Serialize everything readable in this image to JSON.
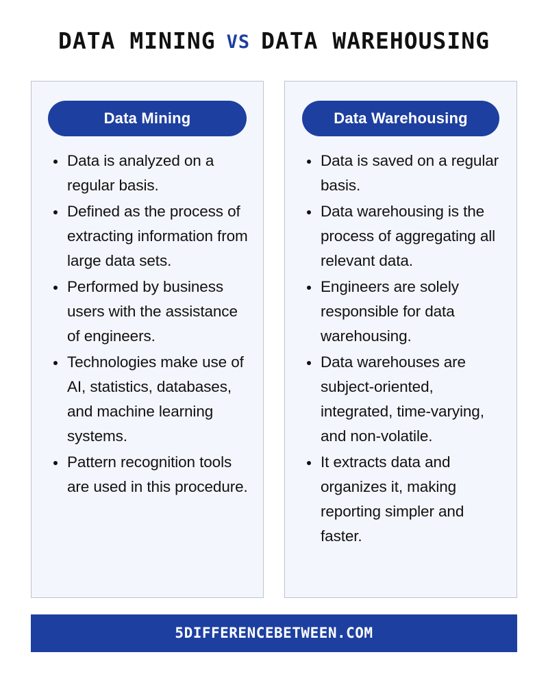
{
  "title": {
    "left": "DATA MINING",
    "vs": "VS",
    "right": "DATA WAREHOUSING"
  },
  "colors": {
    "brand_blue": "#1d3fa0",
    "card_background": "#f4f6fd",
    "card_border": "#bfc3cc",
    "page_background": "#ffffff",
    "text": "#111111"
  },
  "columns": [
    {
      "heading": "Data Mining",
      "points": [
        "Data is analyzed on a regular basis.",
        "Defined as the process of extracting information from large data sets.",
        "Performed by business users with the assistance of engineers.",
        "Technologies make use of AI, statistics, databases, and machine learning systems.",
        "Pattern recognition tools are used in this procedure."
      ]
    },
    {
      "heading": "Data Warehousing",
      "points": [
        "Data is saved on a regular basis.",
        "Data warehousing is the process of aggregating all relevant data.",
        "Engineers are solely responsible for data warehousing.",
        "Data warehouses are subject-oriented, integrated, time-varying, and non-volatile.",
        "It extracts data and organizes it, making reporting simpler and faster."
      ]
    }
  ],
  "footer": {
    "text": "5DIFFERENCEBETWEEN.COM"
  }
}
